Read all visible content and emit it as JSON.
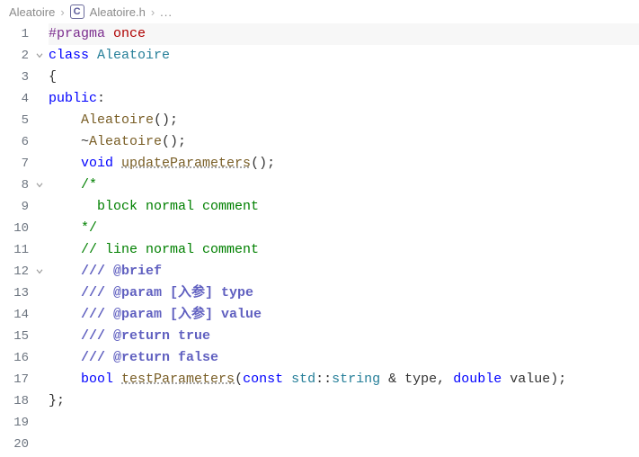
{
  "breadcrumb": {
    "folder": "Aleatoire",
    "file": "Aleatoire.h",
    "file_icon_letter": "C",
    "tail": "..."
  },
  "lines": {
    "1": {
      "num": "1",
      "fold": "",
      "tokens": [
        [
          "pragma",
          "#pragma"
        ],
        [
          "",
          ""
        ],
        [
          "ponce",
          " once"
        ]
      ]
    },
    "2": {
      "num": "2",
      "fold": "open",
      "tokens": [
        [
          "kw",
          "class "
        ],
        [
          "typ",
          "Aleatoire"
        ]
      ]
    },
    "3": {
      "num": "3",
      "fold": "",
      "tokens": [
        [
          "pun",
          "{"
        ]
      ]
    },
    "4": {
      "num": "4",
      "fold": "",
      "tokens": [
        [
          "kw",
          "public"
        ],
        [
          "pun",
          ":"
        ]
      ]
    },
    "5": {
      "num": "5",
      "fold": "",
      "tokens": [
        [
          "",
          "    "
        ],
        [
          "fn",
          "Aleatoire"
        ],
        [
          "pun",
          "();"
        ]
      ]
    },
    "6": {
      "num": "6",
      "fold": "",
      "tokens": [
        [
          "",
          "    ~"
        ],
        [
          "fn",
          "Aleatoire"
        ],
        [
          "pun",
          "();"
        ]
      ]
    },
    "7": {
      "num": "7",
      "fold": "",
      "tokens": [
        [
          "",
          "    "
        ],
        [
          "kw",
          "void "
        ],
        [
          "fn under",
          "updateParameters"
        ],
        [
          "pun",
          "();"
        ]
      ]
    },
    "8": {
      "num": "8",
      "fold": "open",
      "tokens": [
        [
          "",
          "    "
        ],
        [
          "cmt",
          "/*"
        ]
      ]
    },
    "9": {
      "num": "9",
      "fold": "",
      "tokens": [
        [
          "",
          "    "
        ],
        [
          "cmt",
          "  block normal comment"
        ]
      ]
    },
    "10": {
      "num": "10",
      "fold": "",
      "tokens": [
        [
          "",
          "    "
        ],
        [
          "cmt",
          "*/"
        ]
      ]
    },
    "11": {
      "num": "11",
      "fold": "",
      "tokens": [
        [
          "",
          "    "
        ],
        [
          "cmt",
          "// line normal comment"
        ]
      ]
    },
    "12": {
      "num": "12",
      "fold": "open",
      "tokens": [
        [
          "",
          "    "
        ],
        [
          "doc",
          "/// @brief"
        ]
      ]
    },
    "13": {
      "num": "13",
      "fold": "",
      "tokens": [
        [
          "",
          "    "
        ],
        [
          "doc",
          "/// @param [入参] type"
        ]
      ]
    },
    "14": {
      "num": "14",
      "fold": "",
      "tokens": [
        [
          "",
          "    "
        ],
        [
          "doc",
          "/// @param [入参] value"
        ]
      ]
    },
    "15": {
      "num": "15",
      "fold": "",
      "tokens": [
        [
          "",
          "    "
        ],
        [
          "doc",
          "/// @return true"
        ]
      ]
    },
    "16": {
      "num": "16",
      "fold": "",
      "tokens": [
        [
          "",
          "    "
        ],
        [
          "doc",
          "/// @return false"
        ]
      ]
    },
    "17": {
      "num": "17",
      "fold": "",
      "tokens": [
        [
          "",
          "    "
        ],
        [
          "kw",
          "bool "
        ],
        [
          "fn under",
          "testParameters"
        ],
        [
          "pun",
          "("
        ],
        [
          "kw",
          "const "
        ],
        [
          "ns",
          "std"
        ],
        [
          "pun",
          "::"
        ],
        [
          "typ",
          "string"
        ],
        [
          "pun",
          " & "
        ],
        [
          "id",
          "type"
        ],
        [
          "pun",
          ", "
        ],
        [
          "kw",
          "double "
        ],
        [
          "id",
          "value"
        ],
        [
          "pun",
          ");"
        ]
      ]
    },
    "18": {
      "num": "18",
      "fold": "",
      "tokens": [
        [
          "pun",
          "};"
        ]
      ]
    },
    "19": {
      "num": "19",
      "fold": "",
      "tokens": [
        [
          "",
          ""
        ]
      ]
    },
    "20": {
      "num": "20",
      "fold": "",
      "tokens": [
        [
          "",
          ""
        ]
      ]
    }
  },
  "line_order": [
    "1",
    "2",
    "3",
    "4",
    "5",
    "6",
    "7",
    "8",
    "9",
    "10",
    "11",
    "12",
    "13",
    "14",
    "15",
    "16",
    "17",
    "18",
    "19",
    "20"
  ]
}
